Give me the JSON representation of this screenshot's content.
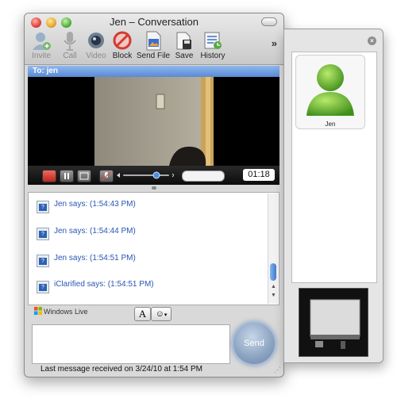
{
  "window": {
    "title": "Jen – Conversation"
  },
  "toolbar": {
    "invite": "Invite",
    "call": "Call",
    "video": "Video",
    "block": "Block",
    "send_file": "Send File",
    "save": "Save",
    "history": "History",
    "more": "»"
  },
  "to_bar": {
    "label": "To: jen"
  },
  "call_timer": "01:18",
  "messages": [
    {
      "text": "Jen says: (1:54:43 PM)"
    },
    {
      "text": "Jen says: (1:54:44 PM)"
    },
    {
      "text": "Jen says: (1:54:51 PM)"
    },
    {
      "text": "iClarified says: (1:54:51 PM)"
    }
  ],
  "bottom": {
    "brand": "Windows Live",
    "font_button": "A",
    "send": "Send",
    "status": "Last message received on 3/24/10 at 1:54 PM"
  },
  "side": {
    "contact_name": "Jen"
  },
  "colors": {
    "accent": "#5a8ad6",
    "link_text": "#2a55b3"
  }
}
